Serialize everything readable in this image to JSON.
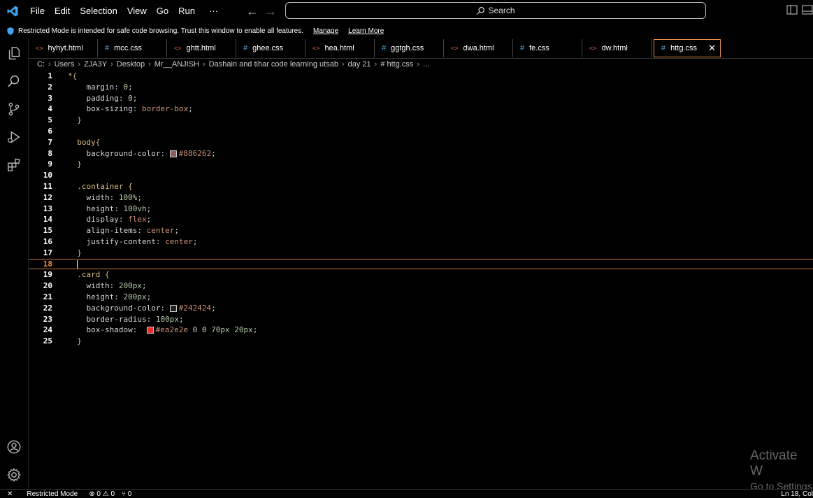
{
  "menu": [
    "File",
    "Edit",
    "Selection",
    "View",
    "Go",
    "Run",
    "···"
  ],
  "search": {
    "label": "Search"
  },
  "restricted": {
    "message": "Restricted Mode is intended for safe code browsing. Trust this window to enable all features.",
    "manage": "Manage",
    "learn_more": "Learn More"
  },
  "tabs": [
    {
      "label": "hyhyt.html",
      "kind": "html"
    },
    {
      "label": "mcc.css",
      "kind": "css"
    },
    {
      "label": "ghtt.html",
      "kind": "html"
    },
    {
      "label": "ghee.css",
      "kind": "css"
    },
    {
      "label": "hea.html",
      "kind": "html"
    },
    {
      "label": "ggtgh.css",
      "kind": "css"
    },
    {
      "label": "dwa.html",
      "kind": "html"
    },
    {
      "label": "fe.css",
      "kind": "css"
    },
    {
      "label": "dw.html",
      "kind": "html"
    },
    {
      "label": "httg.css",
      "kind": "css",
      "active": true
    }
  ],
  "breadcrumb": [
    "C:",
    "Users",
    "ZJA3Y",
    "Desktop",
    "Mr__ANJISH",
    "Dashain and tihar code learning utsab",
    "day 21",
    "# httg.css",
    "..."
  ],
  "code_lines": [
    "*{",
    "    margin: 0;",
    "    padding: 0;",
    "    box-sizing: border-box;",
    "  }",
    "",
    "  body{",
    "    background-color: #886262;",
    "  }",
    "",
    "  .container {",
    "    width: 100%;",
    "    height: 100vh;",
    "    display: flex;",
    "    align-items: center;",
    "    justify-content: center;",
    "  }",
    "  ",
    "  .card {",
    "    width: 200px;",
    "    height: 200px;",
    "    background-color: #242424;",
    "    border-radius: 100px;",
    "    box-shadow:  #ea2e2e 0 0 70px 20px;",
    "  }"
  ],
  "current_line": 18,
  "swatch_colors": {
    "line8": "#886262",
    "line22": "#242424",
    "line24": "#ea2e2e"
  },
  "watermark": {
    "line1": "Activate W",
    "line2": "Go to Settings"
  },
  "status": {
    "restricted": "Restricted Mode",
    "problems": "⊗ 0 ⚠ 0",
    "ports": "⑂ 0",
    "position": "Ln 18, Col"
  }
}
